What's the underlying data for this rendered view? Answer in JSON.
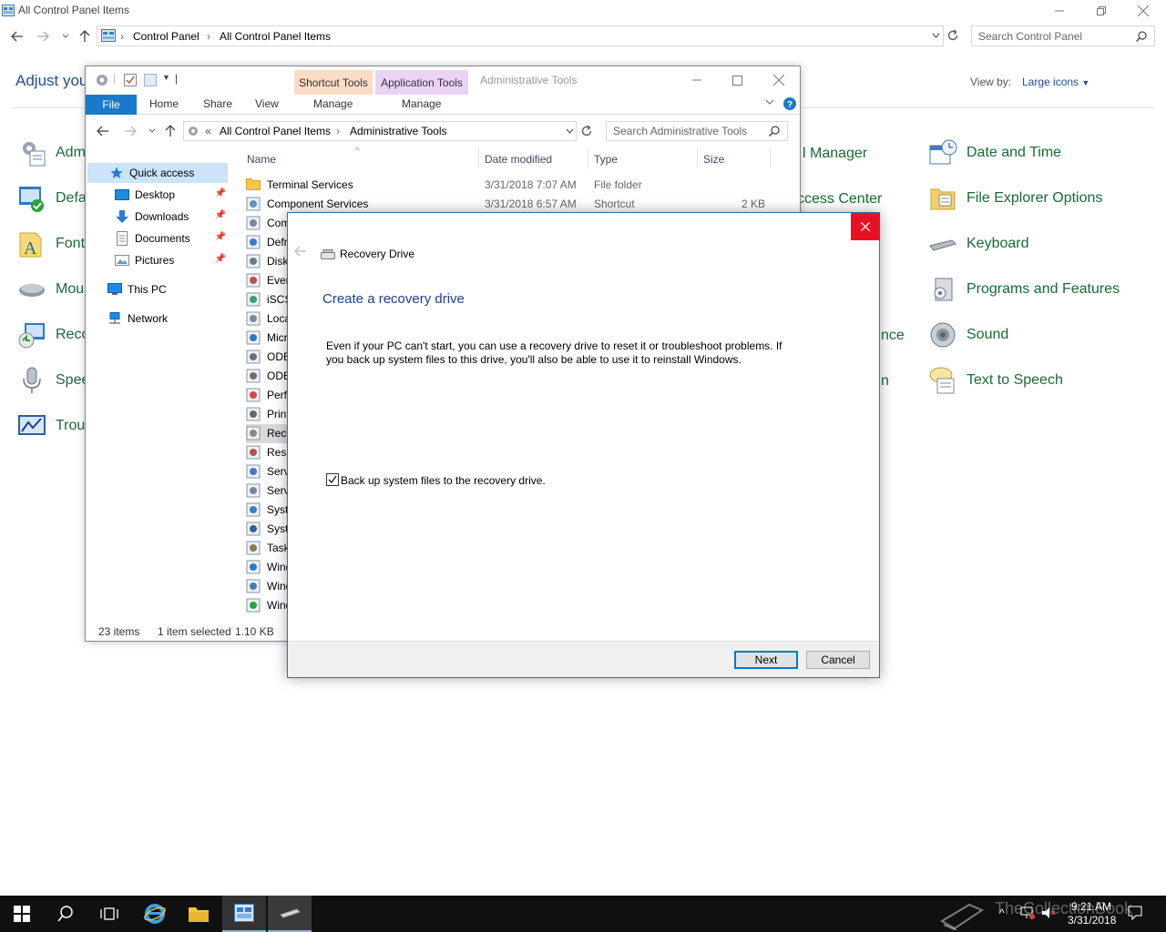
{
  "control_panel": {
    "window_title": "All Control Panel Items",
    "breadcrumb": [
      "Control Panel",
      "All Control Panel Items"
    ],
    "search_placeholder": "Search Control Panel",
    "heading": "Adjust your",
    "view_by_label": "View by:",
    "view_by_value": "Large icons",
    "left_items": [
      "Adm",
      "Defa",
      "Font",
      "Mou",
      "Reco",
      "Spee",
      "Trou"
    ],
    "middle_items": [
      "l Manager",
      "ccess Center",
      "nce",
      "n"
    ],
    "right_items": [
      "Date and Time",
      "File Explorer Options",
      "Keyboard",
      "Programs and Features",
      "Sound",
      "Text to Speech"
    ]
  },
  "explorer": {
    "window_title": "Administrative Tools",
    "context_tabs": [
      {
        "label": "Shortcut Tools",
        "sub": "Manage",
        "color": "#f9d3b7"
      },
      {
        "label": "Application Tools",
        "sub": "Manage",
        "color": "#e6c8f1"
      }
    ],
    "ribbon_tabs": [
      "File",
      "Home",
      "Share",
      "View"
    ],
    "breadcrumb_prefix": "«",
    "breadcrumb": [
      "All Control Panel Items",
      "Administrative Tools"
    ],
    "search_placeholder": "Search Administrative Tools",
    "nav": {
      "quick_access": "Quick access",
      "items": [
        "Desktop",
        "Downloads",
        "Documents",
        "Pictures"
      ],
      "this_pc": "This PC",
      "network": "Network"
    },
    "columns": {
      "name": "Name",
      "date": "Date modified",
      "type": "Type",
      "size": "Size"
    },
    "files": [
      {
        "name": "Terminal Services",
        "date": "3/31/2018 7:07 AM",
        "type": "File folder",
        "size": ""
      },
      {
        "name": "Component Services",
        "date": "3/31/2018 6:57 AM",
        "type": "Shortcut",
        "size": "2 KB"
      },
      {
        "name": "Com",
        "date": "",
        "type": "",
        "size": ""
      },
      {
        "name": "Defr",
        "date": "",
        "type": "",
        "size": ""
      },
      {
        "name": "Disk",
        "date": "",
        "type": "",
        "size": ""
      },
      {
        "name": "Even",
        "date": "",
        "type": "",
        "size": ""
      },
      {
        "name": "iSCS",
        "date": "",
        "type": "",
        "size": ""
      },
      {
        "name": "Loca",
        "date": "",
        "type": "",
        "size": ""
      },
      {
        "name": "Micr",
        "date": "",
        "type": "",
        "size": ""
      },
      {
        "name": "ODB",
        "date": "",
        "type": "",
        "size": ""
      },
      {
        "name": "ODB",
        "date": "",
        "type": "",
        "size": ""
      },
      {
        "name": "Perf",
        "date": "",
        "type": "",
        "size": ""
      },
      {
        "name": "Print",
        "date": "",
        "type": "",
        "size": ""
      },
      {
        "name": "Reco",
        "date": "",
        "type": "",
        "size": ""
      },
      {
        "name": "Reso",
        "date": "",
        "type": "",
        "size": ""
      },
      {
        "name": "Serv",
        "date": "",
        "type": "",
        "size": ""
      },
      {
        "name": "Serv",
        "date": "",
        "type": "",
        "size": ""
      },
      {
        "name": "Syst",
        "date": "",
        "type": "",
        "size": ""
      },
      {
        "name": "Syst",
        "date": "",
        "type": "",
        "size": ""
      },
      {
        "name": "Task",
        "date": "",
        "type": "",
        "size": ""
      },
      {
        "name": "Wind",
        "date": "",
        "type": "",
        "size": ""
      },
      {
        "name": "Wind",
        "date": "",
        "type": "",
        "size": ""
      },
      {
        "name": "Wind",
        "date": "",
        "type": "",
        "size": ""
      }
    ],
    "status": {
      "count": "23 items",
      "selected": "1 item selected",
      "size": "1.10 KB"
    }
  },
  "dialog": {
    "title": "Recovery Drive",
    "heading": "Create a recovery drive",
    "description": "Even if your PC can't start, you can use a recovery drive to reset it or troubleshoot problems. If you back up system files to this drive, you'll also be able to use it to reinstall Windows.",
    "checkbox_label": "Back up system files to the recovery drive.",
    "checkbox_checked": true,
    "next_label": "Next",
    "cancel_label": "Cancel"
  },
  "taskbar": {
    "time": "9:21 AM",
    "date": "3/31/2018",
    "watermark": "TheCollectionBook"
  }
}
